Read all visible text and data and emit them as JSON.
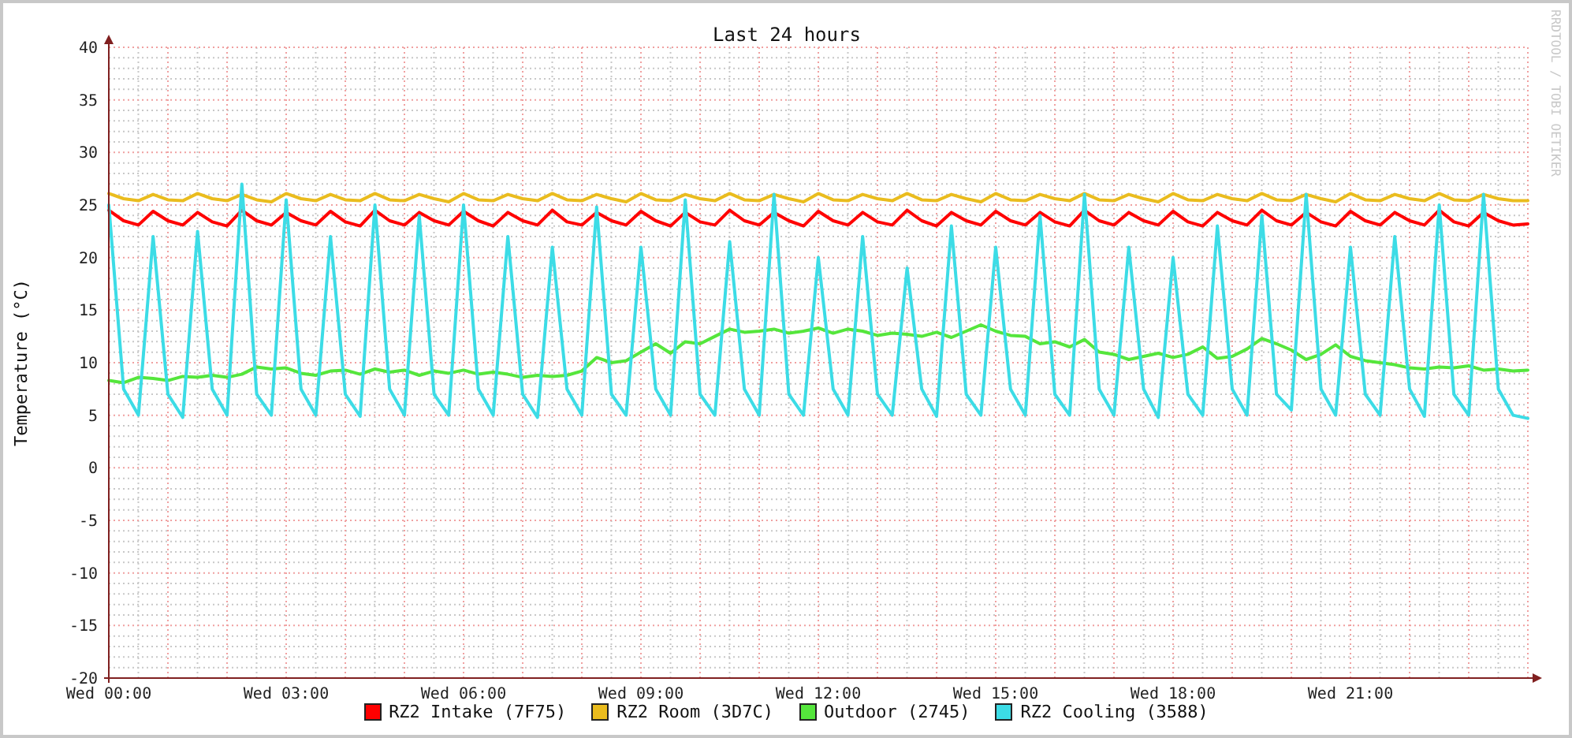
{
  "graph": {
    "credit": "RRDTOOL / TOBI OETIKER",
    "chart_data": {
      "type": "line",
      "title": "Last 24 hours",
      "ylabel": "Temperature (°C)",
      "grid": true,
      "ylim": [
        -20,
        40
      ],
      "yticks": [
        -20,
        -15,
        -10,
        -5,
        0,
        5,
        10,
        15,
        20,
        25,
        30,
        35,
        40
      ],
      "categories": [
        "Wed 00:00",
        null,
        null,
        null,
        null,
        null,
        null,
        null,
        null,
        null,
        null,
        null,
        "Wed 03:00",
        null,
        null,
        null,
        null,
        null,
        null,
        null,
        null,
        null,
        null,
        null,
        "Wed 06:00",
        null,
        null,
        null,
        null,
        null,
        null,
        null,
        null,
        null,
        null,
        null,
        "Wed 09:00",
        null,
        null,
        null,
        null,
        null,
        null,
        null,
        null,
        null,
        null,
        null,
        "Wed 12:00",
        null,
        null,
        null,
        null,
        null,
        null,
        null,
        null,
        null,
        null,
        null,
        "Wed 15:00",
        null,
        null,
        null,
        null,
        null,
        null,
        null,
        null,
        null,
        null,
        null,
        "Wed 18:00",
        null,
        null,
        null,
        null,
        null,
        null,
        null,
        null,
        null,
        null,
        null,
        "Wed 21:00",
        null,
        null,
        null,
        null,
        null,
        null,
        null,
        null,
        null,
        null,
        null,
        null
      ],
      "series": [
        {
          "name": "RZ2 Intake (7F75)",
          "color": "#ff0000",
          "values": [
            24.5,
            23.5,
            23.1,
            24.4,
            23.5,
            23.1,
            24.3,
            23.4,
            23.0,
            24.5,
            23.5,
            23.1,
            24.3,
            23.5,
            23.1,
            24.4,
            23.4,
            23.0,
            24.5,
            23.5,
            23.1,
            24.3,
            23.5,
            23.1,
            24.4,
            23.5,
            23.0,
            24.3,
            23.5,
            23.1,
            24.5,
            23.4,
            23.1,
            24.3,
            23.5,
            23.1,
            24.4,
            23.5,
            23.0,
            24.3,
            23.4,
            23.1,
            24.5,
            23.5,
            23.1,
            24.3,
            23.5,
            23.0,
            24.4,
            23.5,
            23.1,
            24.3,
            23.4,
            23.1,
            24.5,
            23.5,
            23.0,
            24.3,
            23.5,
            23.1,
            24.4,
            23.5,
            23.1,
            24.3,
            23.4,
            23.0,
            24.5,
            23.5,
            23.1,
            24.3,
            23.5,
            23.1,
            24.4,
            23.4,
            23.0,
            24.3,
            23.5,
            23.1,
            24.5,
            23.5,
            23.1,
            24.3,
            23.4,
            23.0,
            24.4,
            23.5,
            23.1,
            24.3,
            23.5,
            23.1,
            24.5,
            23.4,
            23.0,
            24.3,
            23.5,
            23.1,
            23.2
          ]
        },
        {
          "name": "RZ2 Room (3D7C)",
          "color": "#eabc1e",
          "values": [
            26.1,
            25.6,
            25.4,
            26.0,
            25.5,
            25.4,
            26.1,
            25.6,
            25.4,
            26.0,
            25.5,
            25.3,
            26.1,
            25.6,
            25.4,
            26.0,
            25.5,
            25.4,
            26.1,
            25.5,
            25.4,
            26.0,
            25.6,
            25.3,
            26.1,
            25.5,
            25.4,
            26.0,
            25.6,
            25.4,
            26.1,
            25.5,
            25.4,
            26.0,
            25.6,
            25.3,
            26.1,
            25.5,
            25.4,
            26.0,
            25.6,
            25.4,
            26.1,
            25.5,
            25.4,
            26.0,
            25.6,
            25.3,
            26.1,
            25.5,
            25.4,
            26.0,
            25.6,
            25.4,
            26.1,
            25.5,
            25.4,
            26.0,
            25.6,
            25.3,
            26.1,
            25.5,
            25.4,
            26.0,
            25.6,
            25.4,
            26.1,
            25.5,
            25.4,
            26.0,
            25.6,
            25.3,
            26.1,
            25.5,
            25.4,
            26.0,
            25.6,
            25.4,
            26.1,
            25.5,
            25.4,
            26.0,
            25.6,
            25.3,
            26.1,
            25.5,
            25.4,
            26.0,
            25.6,
            25.4,
            26.1,
            25.5,
            25.4,
            26.0,
            25.6,
            25.4,
            25.4
          ]
        },
        {
          "name": "Outdoor (2745)",
          "color": "#55e63c",
          "values": [
            8.3,
            8.1,
            8.6,
            8.5,
            8.3,
            8.7,
            8.6,
            8.8,
            8.6,
            8.9,
            9.6,
            9.4,
            9.5,
            9.0,
            8.8,
            9.2,
            9.3,
            8.9,
            9.4,
            9.1,
            9.3,
            8.8,
            9.2,
            9.0,
            9.3,
            8.9,
            9.1,
            8.9,
            8.6,
            8.8,
            8.7,
            8.8,
            9.2,
            10.5,
            10.0,
            10.2,
            11.0,
            11.8,
            10.9,
            12.0,
            11.8,
            12.5,
            13.2,
            12.9,
            13.0,
            13.2,
            12.8,
            13.0,
            13.3,
            12.8,
            13.2,
            13.0,
            12.6,
            12.8,
            12.7,
            12.5,
            12.9,
            12.4,
            13.0,
            13.6,
            13.0,
            12.6,
            12.5,
            11.8,
            12.0,
            11.5,
            12.2,
            11.0,
            10.8,
            10.3,
            10.6,
            10.9,
            10.5,
            10.8,
            11.5,
            10.4,
            10.6,
            11.3,
            12.3,
            11.8,
            11.2,
            10.3,
            10.8,
            11.7,
            10.6,
            10.2,
            10.0,
            9.8,
            9.5,
            9.4,
            9.6,
            9.5,
            9.7,
            9.3,
            9.4,
            9.2,
            9.3
          ]
        },
        {
          "name": "RZ2 Cooling (3588)",
          "color": "#3cdce6",
          "values": [
            25,
            7.5,
            5,
            22,
            7,
            4.8,
            22.5,
            7.5,
            5,
            27,
            7,
            5,
            25.5,
            7.5,
            5,
            22,
            7,
            4.9,
            25,
            7.5,
            5,
            24,
            7,
            5,
            25,
            7.5,
            5,
            22,
            7,
            4.8,
            21,
            7.5,
            5,
            24.8,
            7,
            5,
            21,
            7.5,
            5,
            25.5,
            7,
            5,
            21.5,
            7.5,
            5,
            26,
            7,
            5,
            20,
            7.5,
            5,
            22,
            7,
            5,
            19,
            7.5,
            4.9,
            23,
            7,
            5,
            21,
            7.5,
            5,
            24,
            7,
            5,
            26,
            7.5,
            5,
            21,
            7.5,
            4.8,
            20,
            7,
            5,
            23,
            7.5,
            5,
            24,
            7,
            5.5,
            26,
            7.5,
            5,
            21,
            7,
            5,
            22,
            7.5,
            4.9,
            25,
            7,
            5,
            26,
            7.5,
            5,
            4.7
          ]
        }
      ]
    }
  }
}
